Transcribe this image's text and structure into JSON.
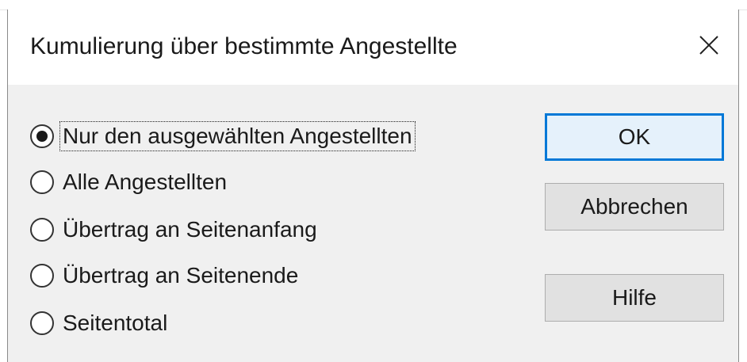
{
  "dialog": {
    "title": "Kumulierung über bestimmte Angestellte",
    "close_icon": "close-icon"
  },
  "options": [
    {
      "label": "Nur den ausgewählten Angestellten",
      "selected": true
    },
    {
      "label": "Alle Angestellten",
      "selected": false
    },
    {
      "label": "Übertrag an Seitenanfang",
      "selected": false
    },
    {
      "label": "Übertrag an Seitenende",
      "selected": false
    },
    {
      "label": "Seitentotal",
      "selected": false
    }
  ],
  "buttons": {
    "ok": "OK",
    "cancel": "Abbrechen",
    "help": "Hilfe"
  },
  "colors": {
    "accent": "#0078d7",
    "dialog_background": "#f0f0f0",
    "button_face": "#e1e1e1"
  }
}
